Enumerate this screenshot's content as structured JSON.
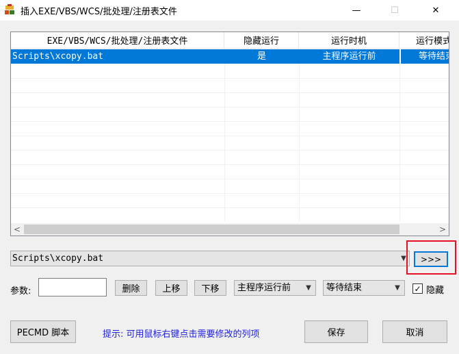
{
  "window": {
    "title": "插入EXE/VBS/WCS/批处理/注册表文件",
    "minimize": "—",
    "maximize": "☐",
    "close": "✕"
  },
  "list": {
    "columns": [
      "EXE/VBS/WCS/批处理/注册表文件",
      "隐藏运行",
      "运行时机",
      "运行模式"
    ],
    "rows": [
      [
        "Scripts\\xcopy.bat",
        "是",
        "主程序运行前",
        "等待结束"
      ]
    ]
  },
  "hscroll": {
    "left": "<",
    "right": ">"
  },
  "file_combo": {
    "value": "Scripts\\xcopy.bat"
  },
  "browse_button": {
    "label": ">>>"
  },
  "params": {
    "label": "参数:",
    "value": "",
    "delete_label": "删除",
    "up_label": "上移",
    "down_label": "下移",
    "timing_value": "主程序运行前",
    "wait_value": "等待结束",
    "hide_checked": true,
    "hide_label": "隐藏"
  },
  "footer": {
    "pecmd_label": "PECMD 脚本",
    "hint": "提示: 可用鼠标右键点击需要修改的列项",
    "save_label": "保存",
    "cancel_label": "取消"
  },
  "colors": {
    "selection": "#0078d7",
    "highlight_box": "#e81123",
    "hint_text": "#1e1ee0"
  }
}
